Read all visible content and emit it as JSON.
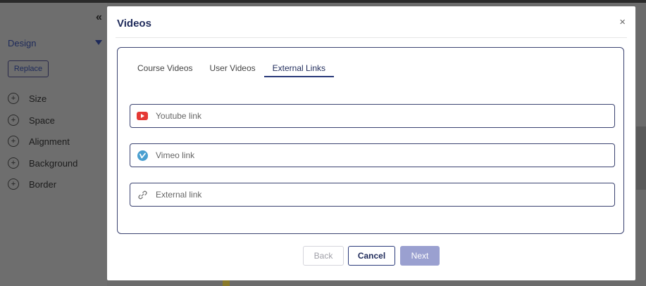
{
  "sidebar": {
    "collapse_label": "«",
    "design_label": "Design",
    "replace_label": "Replace",
    "items": [
      {
        "label": "Size",
        "icon": "plus-circle-icon"
      },
      {
        "label": "Space",
        "icon": "plus-circle-icon"
      },
      {
        "label": "Alignment",
        "icon": "plus-circle-icon"
      },
      {
        "label": "Background",
        "icon": "plus-circle-icon"
      },
      {
        "label": "Border",
        "icon": "plus-circle-icon"
      }
    ]
  },
  "modal": {
    "title": "Videos",
    "close_label": "×",
    "tabs": [
      {
        "label": "Course Videos",
        "active": false
      },
      {
        "label": "User Videos",
        "active": false
      },
      {
        "label": "External Links",
        "active": true
      }
    ],
    "fields": [
      {
        "placeholder": "Youtube link",
        "value": "",
        "icon": "youtube-icon"
      },
      {
        "placeholder": "Vimeo link",
        "value": "",
        "icon": "vimeo-icon"
      },
      {
        "placeholder": "External link",
        "value": "",
        "icon": "link-icon"
      }
    ],
    "buttons": {
      "back": "Back",
      "cancel": "Cancel",
      "next": "Next"
    }
  },
  "colors": {
    "accent": "#2a3a7a",
    "next_button": "#9aa0d0",
    "youtube": "#e53935",
    "vimeo": "#4a9fd0"
  }
}
